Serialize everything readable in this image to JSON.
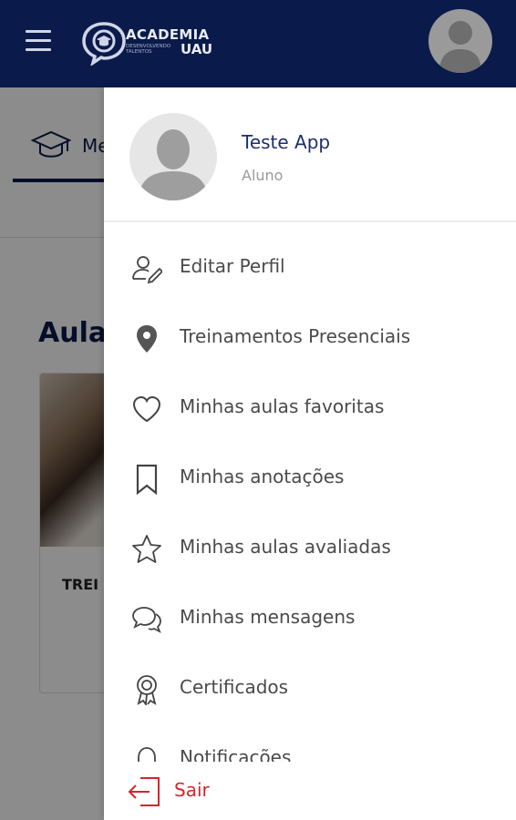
{
  "header": {
    "logo_title": "ACADEMIA",
    "logo_subtitle": "DESENVOLVENDO TALENTOS",
    "logo_uau": "UAU"
  },
  "background": {
    "tab_label": "Me",
    "section_title": "Aula",
    "card_title": "TREI"
  },
  "drawer": {
    "user_name": "Teste App",
    "user_role": "Aluno",
    "items": [
      {
        "label": "Editar Perfil",
        "icon": "edit-profile-icon"
      },
      {
        "label": "Treinamentos Presenciais",
        "icon": "location-pin-icon"
      },
      {
        "label": "Minhas aulas favoritas",
        "icon": "heart-icon"
      },
      {
        "label": "Minhas anotações",
        "icon": "bookmark-icon"
      },
      {
        "label": "Minhas aulas avaliadas",
        "icon": "star-icon"
      },
      {
        "label": "Minhas mensagens",
        "icon": "chat-bubbles-icon"
      },
      {
        "label": "Certificados",
        "icon": "award-icon"
      },
      {
        "label": "Notificações",
        "icon": "bell-icon"
      }
    ],
    "logout_label": "Sair"
  },
  "colors": {
    "header_bg": "#0a1a4a",
    "logout_red": "#d3262c",
    "name_blue": "#1d2f6b"
  }
}
